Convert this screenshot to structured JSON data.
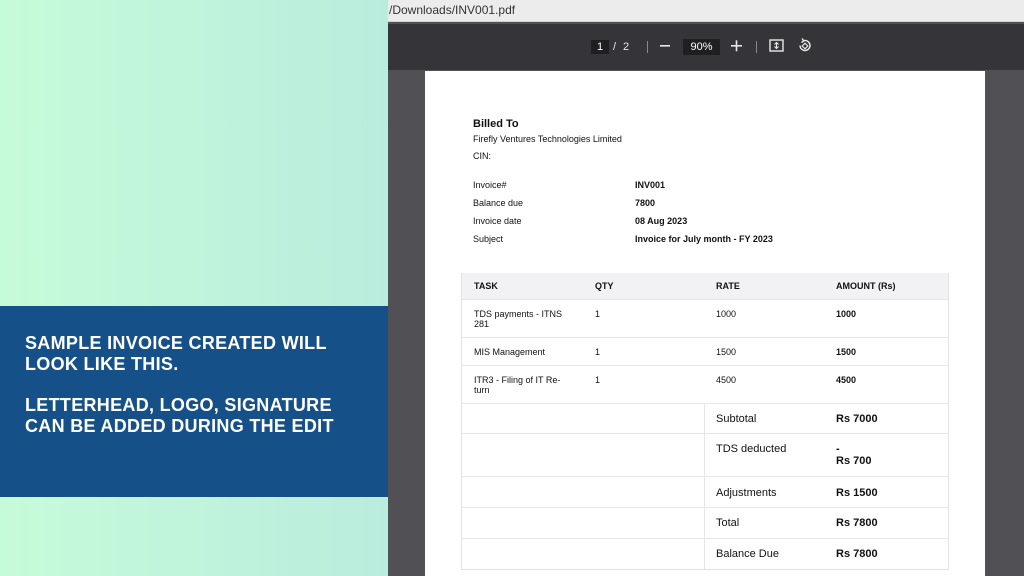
{
  "caption": {
    "line1": "Sample invoice created will\nlook like this.",
    "line2": "Letterhead, logo, signature\ncan be added during the edit"
  },
  "browser": {
    "url_fragment": "/Downloads/INV001.pdf"
  },
  "pdf_toolbar": {
    "current_page": "1",
    "separator": "/",
    "total_pages": "2",
    "zoom": "90%",
    "icons": [
      "minus-icon",
      "plus-icon",
      "fit-page-icon",
      "rotate-icon"
    ]
  },
  "invoice": {
    "billed_to_label": "Billed To",
    "billed_to_name": "Firefly Ventures Technologies Limited",
    "cin_label": "CIN:",
    "meta": [
      {
        "label": "Invoice#",
        "value": "INV001"
      },
      {
        "label": "Balance due",
        "value": "7800"
      },
      {
        "label": "Invoice date",
        "value": "08 Aug 2023"
      },
      {
        "label": "Subject",
        "value": "Invoice for July month - FY 2023"
      }
    ],
    "table": {
      "headers": [
        "TASK",
        "QTY",
        "RATE",
        "AMOUNT (Rs)"
      ],
      "rows": [
        {
          "task": "TDS payments - ITNS 281",
          "qty": "1",
          "rate": "1000",
          "amount": "1000"
        },
        {
          "task": "MIS Management",
          "qty": "1",
          "rate": "1500",
          "amount": "1500"
        },
        {
          "task": "ITR3 - Filing of IT Re-turn",
          "qty": "1",
          "rate": "4500",
          "amount": "4500"
        }
      ]
    },
    "summary": [
      {
        "label": "Subtotal",
        "value": "Rs 7000"
      },
      {
        "label": "TDS deducted",
        "value_top": "-",
        "value": "Rs 700"
      },
      {
        "label": "Adjustments",
        "value": "Rs 1500"
      },
      {
        "label": "Total",
        "value": "Rs 7800"
      },
      {
        "label": "Balance Due",
        "value": "Rs 7800"
      }
    ]
  }
}
